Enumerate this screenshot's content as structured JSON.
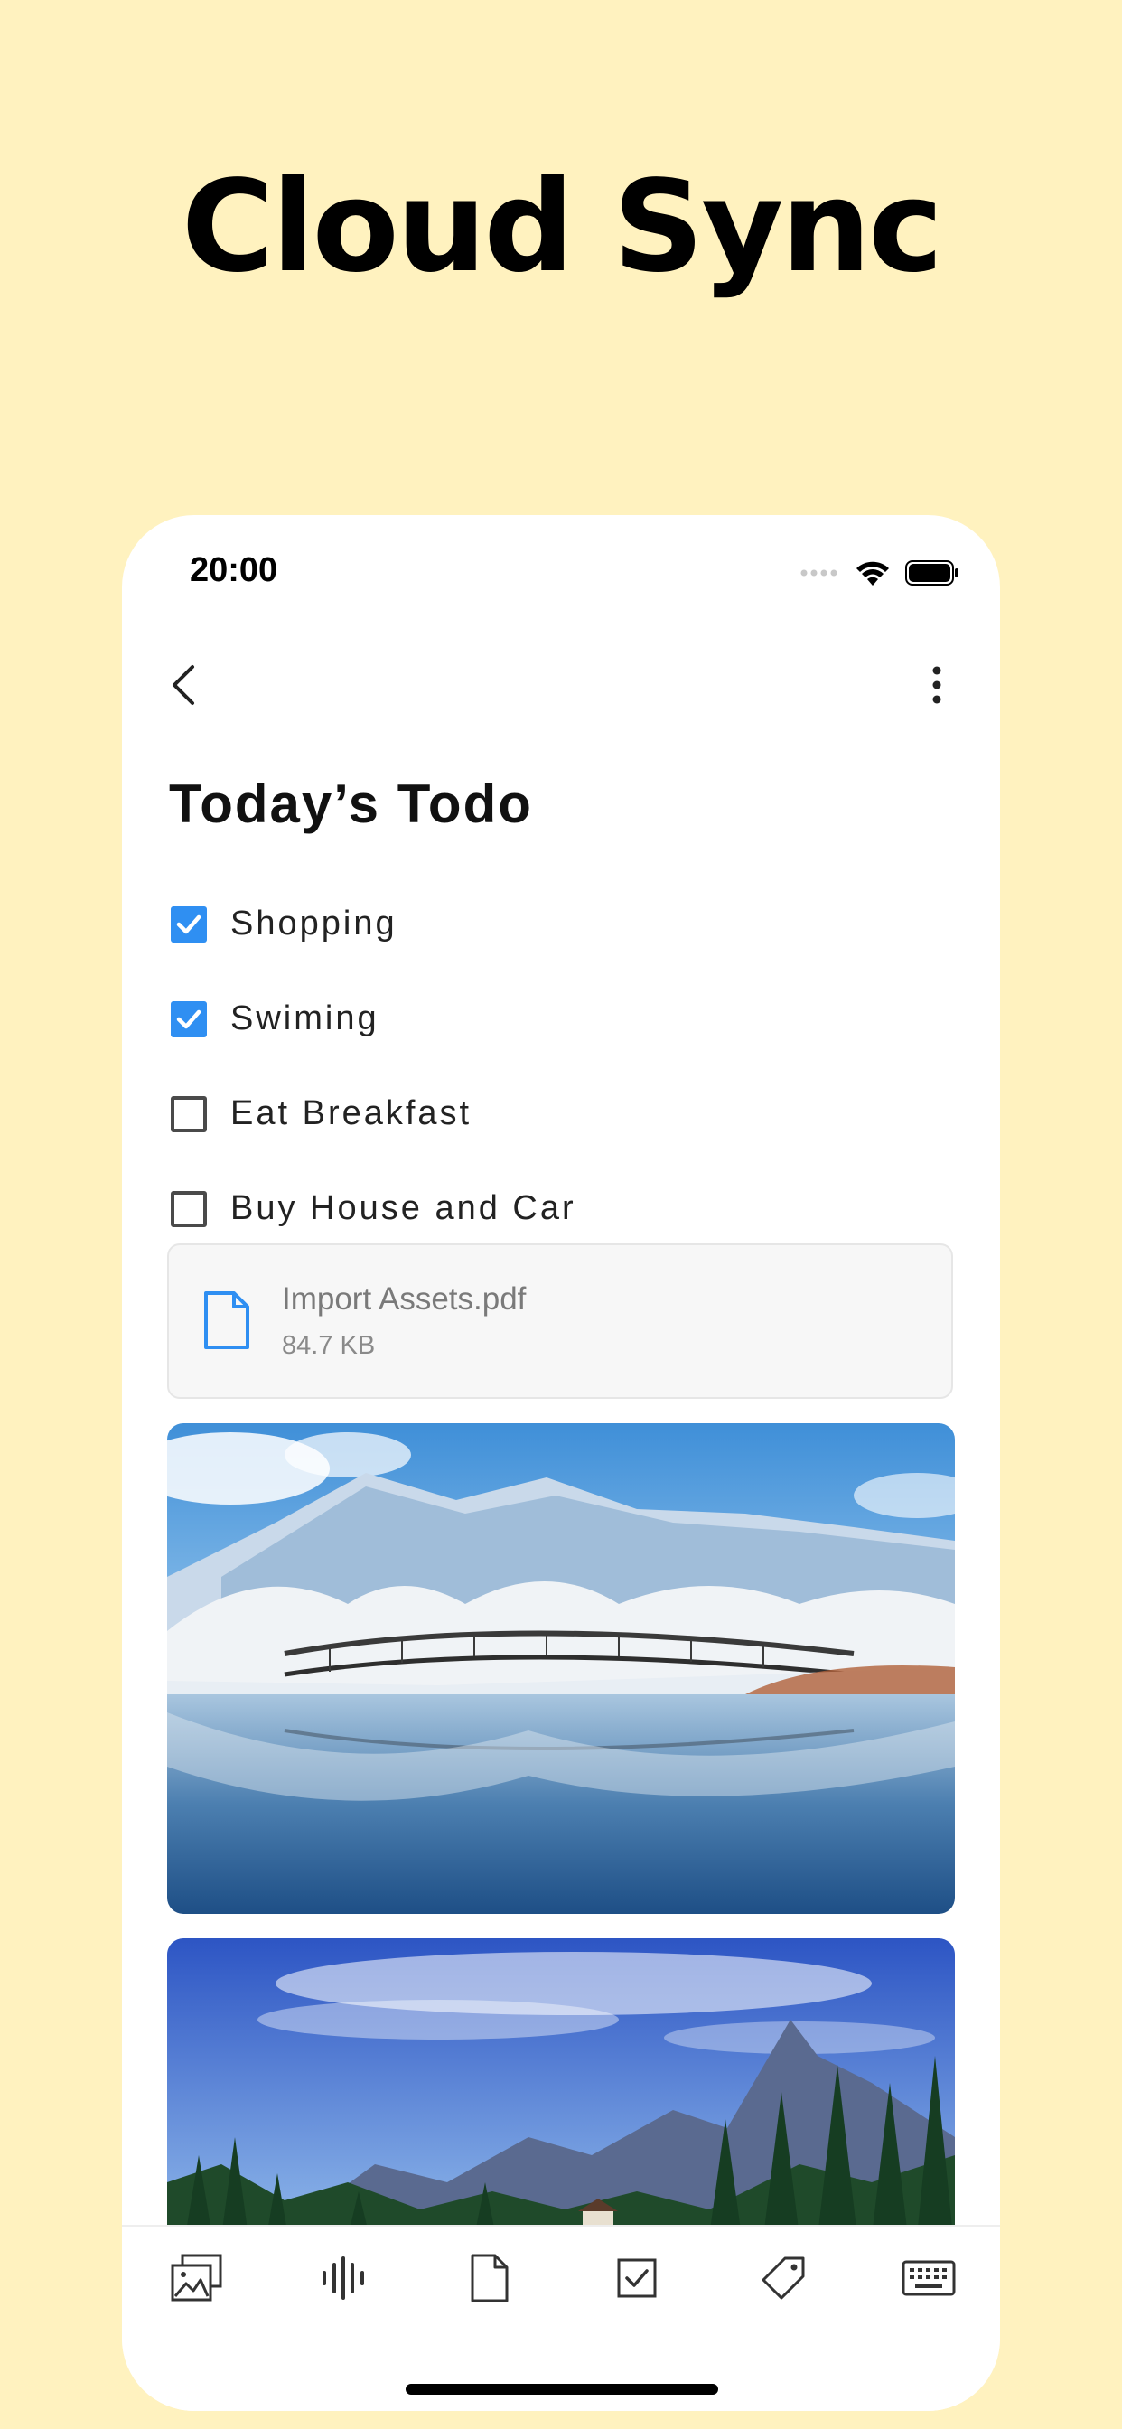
{
  "headline": "Cloud Sync",
  "status_bar": {
    "time": "20:00"
  },
  "note": {
    "title": "Today’s Todo",
    "todos": [
      {
        "label": "Shopping",
        "checked": true
      },
      {
        "label": "Swiming",
        "checked": true
      },
      {
        "label": "Eat Breakfast",
        "checked": false
      },
      {
        "label": "Buy House and Car",
        "checked": false
      }
    ],
    "attachment": {
      "name": "Import Assets.pdf",
      "size": "84.7 KB"
    },
    "images": [
      {
        "description": "snowy-lake-bridge-photo"
      },
      {
        "description": "mountain-forest-photo"
      }
    ]
  },
  "toolbar": {
    "items": [
      "image-icon",
      "audio-waveform-icon",
      "document-icon",
      "checkbox-icon",
      "tag-icon",
      "keyboard-icon"
    ]
  },
  "colors": {
    "background": "#FFF2BF",
    "accent": "#2F8FF2"
  }
}
